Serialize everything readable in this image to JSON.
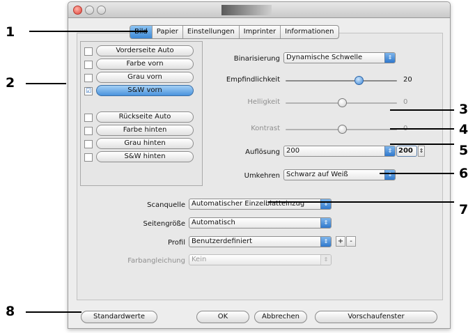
{
  "tabs": [
    "Bild",
    "Papier",
    "Einstellungen",
    "Imprinter",
    "Informationen"
  ],
  "active_tab": "Bild",
  "image_list": [
    {
      "label": "Vorderseite Auto",
      "checked": false
    },
    {
      "label": "Farbe vorn",
      "checked": false
    },
    {
      "label": "Grau vorn",
      "checked": false
    },
    {
      "label": "S&W vorn",
      "checked": true,
      "selected": true
    },
    {
      "label": "Rückseite Auto",
      "checked": false
    },
    {
      "label": "Farbe hinten",
      "checked": false
    },
    {
      "label": "Grau hinten",
      "checked": false
    },
    {
      "label": "S&W hinten",
      "checked": false
    }
  ],
  "settings": {
    "binarization_label": "Binarisierung",
    "binarization_value": "Dynamische Schwelle",
    "sensitivity_label": "Empfindlichkeit",
    "sensitivity_value": "20",
    "brightness_label": "Helligkeit",
    "brightness_value": "0",
    "contrast_label": "Kontrast",
    "contrast_value": "0",
    "resolution_label": "Auflösung",
    "resolution_value": "200",
    "resolution_custom": "200",
    "invert_label": "Umkehren",
    "invert_value": "Schwarz auf Weiß"
  },
  "scan": {
    "source_label": "Scanquelle",
    "source_value": "Automatischer Einzelblatteinzug",
    "pagesize_label": "Seitengröße",
    "pagesize_value": "Automatisch",
    "profile_label": "Profil",
    "profile_value": "Benutzerdefiniert",
    "profile_add": "+",
    "profile_remove": "-",
    "colormatch_label": "Farbangleichung",
    "colormatch_value": "Kein"
  },
  "buttons": {
    "defaults": "Standardwerte",
    "ok": "OK",
    "cancel": "Abbrechen",
    "preview": "Vorschaufenster"
  },
  "callouts": [
    "1",
    "2",
    "3",
    "4",
    "5",
    "6",
    "7",
    "8"
  ],
  "colors": {
    "accent_blue": "#3d88d6",
    "close_red": "#e0443a"
  }
}
